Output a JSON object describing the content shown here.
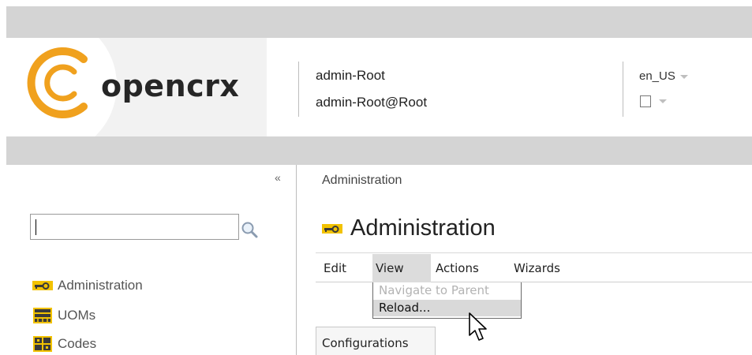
{
  "header": {
    "logo_text": "opencrx",
    "user_name": "admin-Root",
    "user_email": "admin-Root@Root",
    "locale": "en_US",
    "brand_color": "#f0a11e"
  },
  "sidebar": {
    "collapse_label": "«",
    "search": {
      "value": "",
      "placeholder": ""
    },
    "items": [
      {
        "label": "Administration",
        "icon": "key-icon"
      },
      {
        "label": "UOMs",
        "icon": "ruler-icon"
      },
      {
        "label": "Codes",
        "icon": "codes-icon"
      }
    ]
  },
  "main": {
    "breadcrumb": "Administration",
    "title": "Administration",
    "menu": [
      "Edit",
      "View",
      "Actions",
      "Wizards"
    ],
    "view_menu": {
      "items": [
        {
          "label": "Navigate to Parent",
          "enabled": false
        },
        {
          "label": "Reload...",
          "enabled": true
        }
      ]
    },
    "tabs": [
      "Configurations"
    ]
  }
}
